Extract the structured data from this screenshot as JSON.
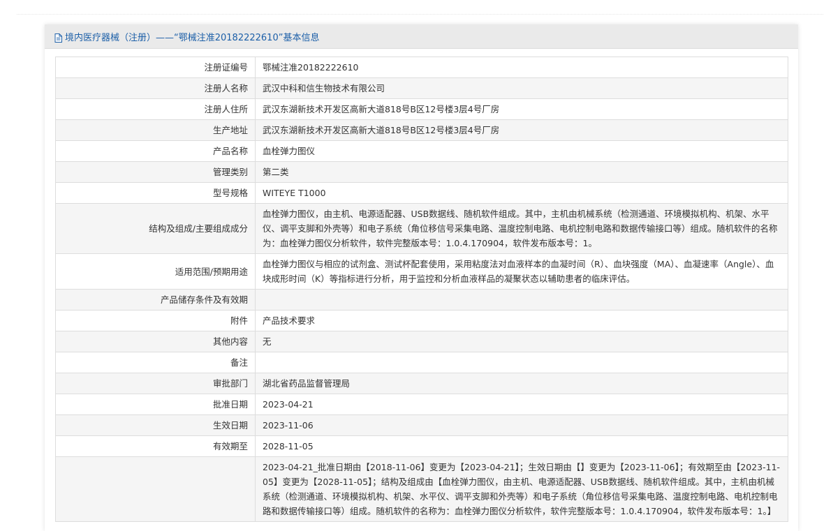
{
  "header": {
    "title": "境内医疗器械（注册）——“鄂械注准20182222610”基本信息"
  },
  "rows": [
    {
      "label": "注册证编号",
      "value": "鄂械注准20182222610"
    },
    {
      "label": "注册人名称",
      "value": "武汉中科和信生物技术有限公司"
    },
    {
      "label": "注册人住所",
      "value": "武汉东湖新技术开发区高新大道818号B区12号楼3层4号厂房"
    },
    {
      "label": "生产地址",
      "value": "武汉东湖新技术开发区高新大道818号B区12号楼3层4号厂房"
    },
    {
      "label": "产品名称",
      "value": "血栓弹力图仪"
    },
    {
      "label": "管理类别",
      "value": "第二类"
    },
    {
      "label": "型号规格",
      "value": "WITEYE T1000"
    },
    {
      "label": "结构及组成/主要组成成分",
      "value": "血栓弹力图仪，由主机、电源适配器、USB数据线、随机软件组成。其中，主机由机械系统（检测通道、环境模拟机构、机架、水平仪、调平支脚和外壳等）和电子系统（角位移信号采集电路、温度控制电路、电机控制电路和数据传输接口等）组成。随机软件的名称为：血栓弹力图仪分析软件，软件完整版本号：1.0.4.170904，软件发布版本号：1。"
    },
    {
      "label": "适用范围/预期用途",
      "value": "血栓弹力图仪与相应的试剂盒、测试杯配套使用，采用粘度法对血液样本的血凝时间（R）、血块强度（MA）、血凝速率（Angle）、血块成形时间（K）等指标进行分析，用于监控和分析血液样品的凝聚状态以辅助患者的临床评估。"
    },
    {
      "label": "产品储存条件及有效期",
      "value": ""
    },
    {
      "label": "附件",
      "value": "产品技术要求"
    },
    {
      "label": "其他内容",
      "value": "无"
    },
    {
      "label": "备注",
      "value": ""
    },
    {
      "label": "审批部门",
      "value": "湖北省药品监督管理局"
    },
    {
      "label": "批准日期",
      "value": "2023-04-21"
    },
    {
      "label": "生效日期",
      "value": "2023-11-06"
    },
    {
      "label": "有效期至",
      "value": "2028-11-05"
    },
    {
      "label": "",
      "value": "2023-04-21_批准日期由【2018-11-06】变更为【2023-04-21】；生效日期由【】变更为【2023-11-06】；有效期至由【2023-11-05】变更为【2028-11-05】；结构及组成由【血栓弹力图仪，由主机、电源适配器、USB数据线、随机软件组成。其中，主机由机械系统（检测通道、环境模拟机构、机架、水平仪、调平支脚和外壳等）和电子系统（角位移信号采集电路、温度控制电路、电机控制电路和数据传输接口等）组成。随机软件的名称为：血栓弹力图仪分析软件，软件完整版本号：1.0.4.170904，软件发布版本号：1。】"
    }
  ]
}
